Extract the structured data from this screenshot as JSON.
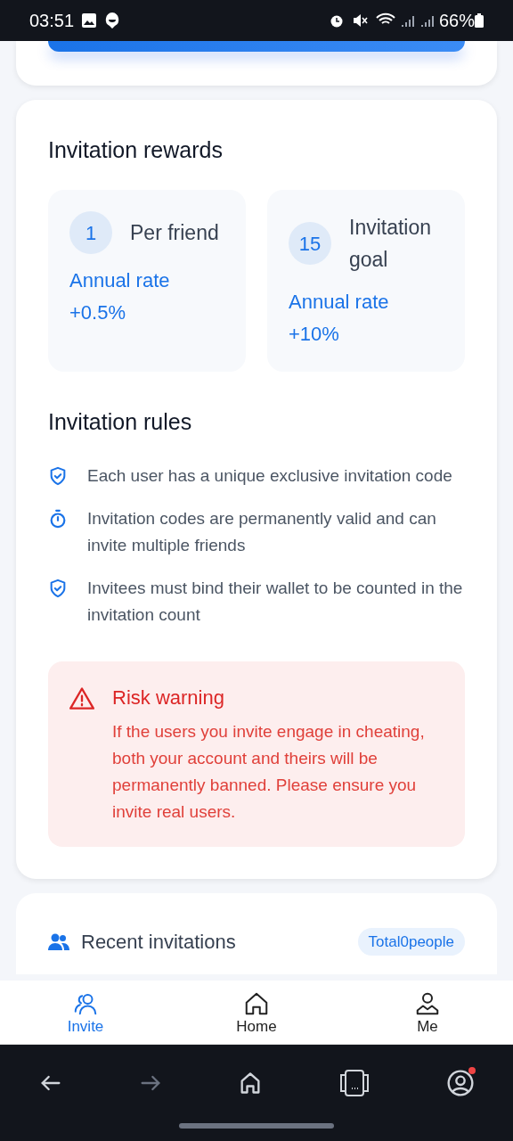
{
  "status_bar": {
    "time": "03:51",
    "battery": "66%"
  },
  "rewards": {
    "title": "Invitation rewards",
    "tiles": [
      {
        "badge": "1",
        "label": "Per friend",
        "rate_label": "Annual rate",
        "rate": "+0.5%"
      },
      {
        "badge": "15",
        "label": "Invitation goal",
        "rate_label": "Annual rate",
        "rate": "+10%"
      }
    ]
  },
  "rules": {
    "title": "Invitation rules",
    "items": [
      {
        "kind": "shield",
        "text": "Each user has a unique exclusive invitation code"
      },
      {
        "kind": "timer",
        "text": "Invitation codes are permanently valid and can invite multiple friends"
      },
      {
        "kind": "shield",
        "text": "Invitees must bind their wallet to be counted in the invitation count"
      }
    ]
  },
  "warning": {
    "title": "Risk warning",
    "text": "If the users you invite engage in cheating, both your account and theirs will be permanently banned. Please ensure you invite real users."
  },
  "recent": {
    "title": "Recent invitations",
    "total": "Total0people"
  },
  "tab_bar": [
    {
      "kind": "invite",
      "label": "Invite",
      "selected": true
    },
    {
      "kind": "home",
      "label": "Home",
      "selected": false
    },
    {
      "kind": "me",
      "label": "Me",
      "selected": false
    }
  ]
}
